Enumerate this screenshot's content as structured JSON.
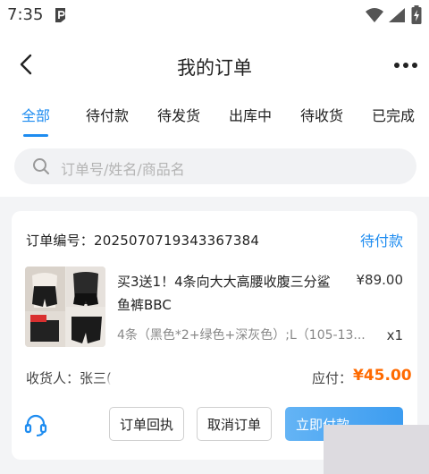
{
  "status_bar": {
    "time": "7:35"
  },
  "header": {
    "title": "我的订单"
  },
  "tabs": [
    {
      "label": "全部",
      "active": true
    },
    {
      "label": "待付款",
      "active": false
    },
    {
      "label": "待发货",
      "active": false
    },
    {
      "label": "出库中",
      "active": false
    },
    {
      "label": "待收货",
      "active": false
    },
    {
      "label": "已完成",
      "active": false
    }
  ],
  "search": {
    "placeholder": "订单号/姓名/商品名"
  },
  "order": {
    "order_no_label": "订单编号：",
    "order_no": "2025070719343367384",
    "status": "待付款",
    "product": {
      "name": "买3送1！4条向大大高腰收腹三分鲨鱼裤BBC",
      "price": "¥89.00",
      "spec": "4条（黑色*2+绿色+深灰色）;L（105-13...",
      "qty": "x1"
    },
    "consignee_label": "收货人：",
    "consignee_name": "张三(",
    "pay_label": "应付：",
    "pay_amount": "¥45.00",
    "buttons": {
      "receipt": "订单回执",
      "cancel": "取消订单",
      "pay": "立即付款"
    }
  },
  "colors": {
    "accent": "#1e8cf0",
    "price_highlight": "#ff6a00"
  },
  "icons": {
    "back": "chevron-left-icon",
    "more": "more-dots-icon",
    "search": "search-icon",
    "service": "headset-icon"
  }
}
